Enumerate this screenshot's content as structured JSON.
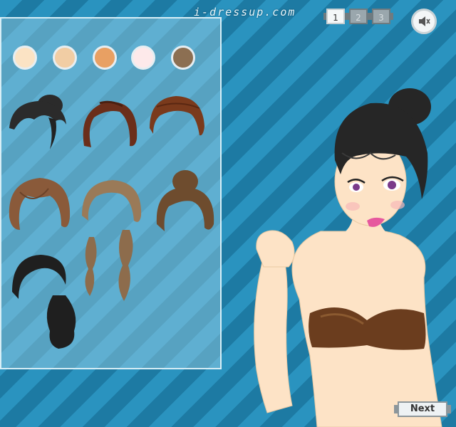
{
  "brand": "i-dressup.com",
  "steps": [
    {
      "label": "1",
      "active": true
    },
    {
      "label": "2",
      "active": false
    },
    {
      "label": "3",
      "active": false
    }
  ],
  "sound_icon": "speaker-mute-icon",
  "skin_tones": [
    "#fbe3c4",
    "#f1cda4",
    "#e8a063",
    "#fde9ea",
    "#8c6f52"
  ],
  "hair_styles": [
    {
      "name": "black-bun",
      "color": "#2b2b2b"
    },
    {
      "name": "auburn-bob",
      "color": "#6b2e1a"
    },
    {
      "name": "brown-swept",
      "color": "#7a3a1c"
    },
    {
      "name": "light-brown-shag",
      "color": "#8a5a3a"
    },
    {
      "name": "ash-brown-waves",
      "color": "#9a7a58"
    },
    {
      "name": "brown-updo",
      "color": "#6e4c2e"
    },
    {
      "name": "black-side-ponytail",
      "color": "#1f1f1f"
    }
  ],
  "next_label": "Next"
}
